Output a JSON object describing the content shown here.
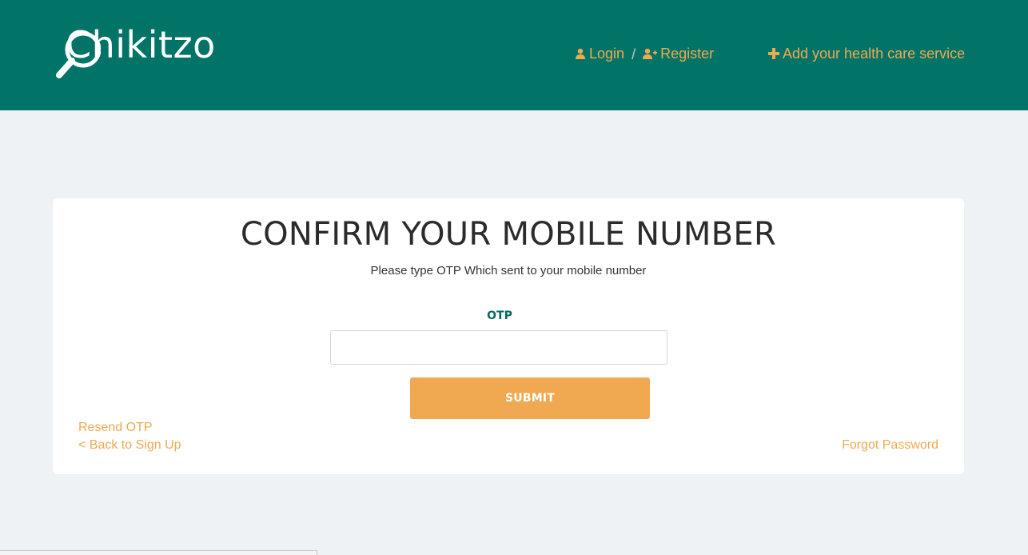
{
  "header": {
    "logo_text": "Chikitzo",
    "nav": {
      "login": "Login",
      "separator": "/",
      "register": "Register",
      "add_service": "Add your health care service"
    }
  },
  "main": {
    "title": "CONFIRM YOUR MOBILE NUMBER",
    "subtitle": "Please type OTP Which sent to your mobile number",
    "otp_label": "OTP",
    "otp_value": "",
    "submit_label": "SUBMIT",
    "resend_label": "Resend OTP",
    "back_label": "< Back to Sign Up",
    "forgot_label": "Forgot Password"
  },
  "colors": {
    "header_bg": "#027367",
    "accent": "#f0a950",
    "page_bg": "#eef2f5"
  },
  "icons": [
    "magnifier-logo-icon",
    "user-icon",
    "user-plus-icon",
    "plus-icon"
  ]
}
